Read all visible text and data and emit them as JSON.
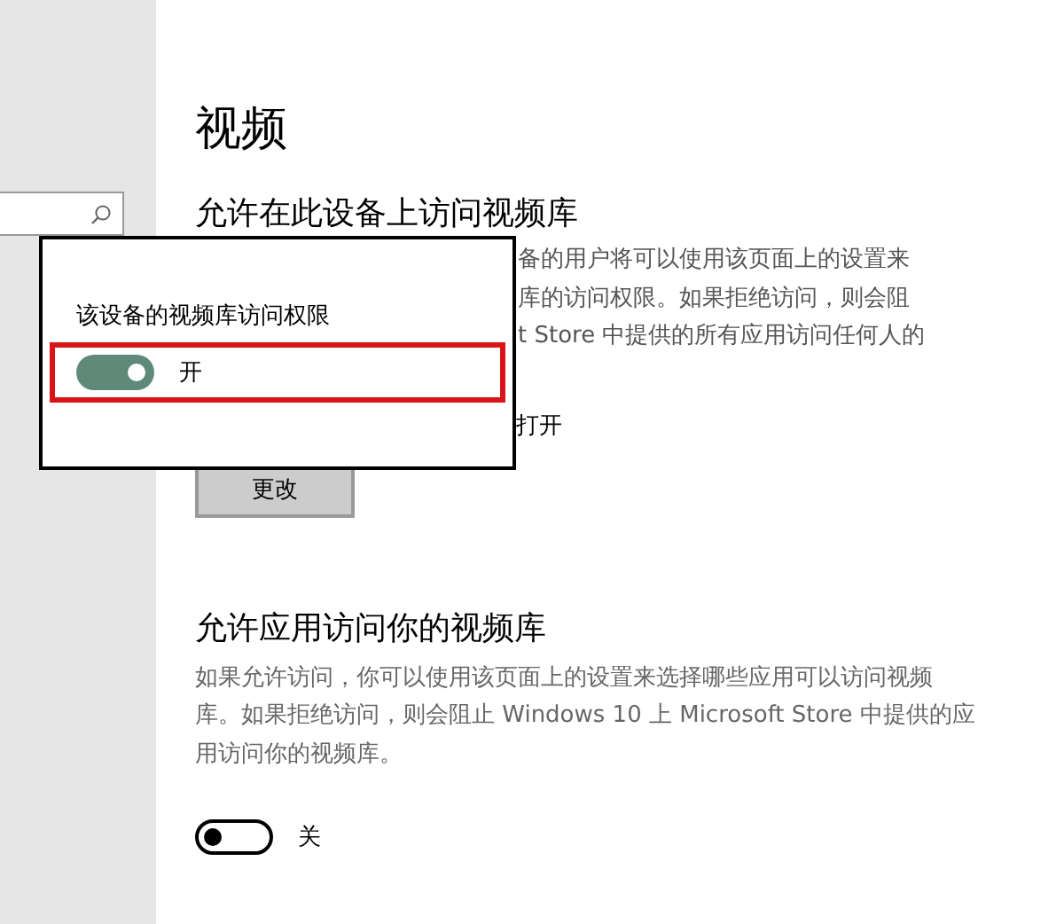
{
  "page_title": "视频",
  "device_section": {
    "heading": "允许在此设备上访问视频库",
    "description_lines": [
      "备的用户将可以使用该页面上的设置来",
      "库的访问权限。如果拒绝访问，则会阻",
      "t Store 中提供的所有应用访问任何人的"
    ],
    "status": "打开",
    "button": "更改"
  },
  "popup": {
    "label": "该设备的视频库访问权限",
    "toggle": {
      "on": true,
      "label": "开"
    }
  },
  "apps_section": {
    "heading": "允许应用访问你的视频库",
    "description": "如果允许访问，你可以使用该页面上的设置来选择哪些应用可以访问视频库。如果拒绝访问，则会阻止 Windows 10 上 Microsoft Store 中提供的应用访问你的视频库。",
    "toggle": {
      "on": false,
      "label": "关"
    }
  }
}
